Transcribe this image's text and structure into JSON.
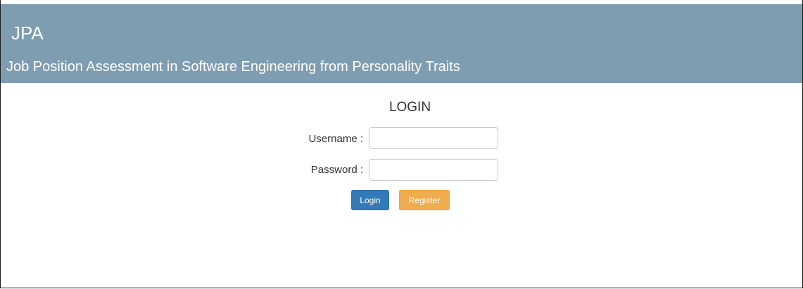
{
  "header": {
    "brand": "JPA",
    "tagline": "Job Position Assessment in Software Engineering from Personality Traits",
    "background_color": "#7f9db0"
  },
  "login_form": {
    "title": "LOGIN",
    "username_label": "Username :",
    "username_value": "",
    "password_label": "Password :",
    "password_value": "",
    "login_button_label": "Login",
    "register_button_label": "Register",
    "login_button_color": "#337ab7",
    "register_button_color": "#f0ad4e"
  }
}
